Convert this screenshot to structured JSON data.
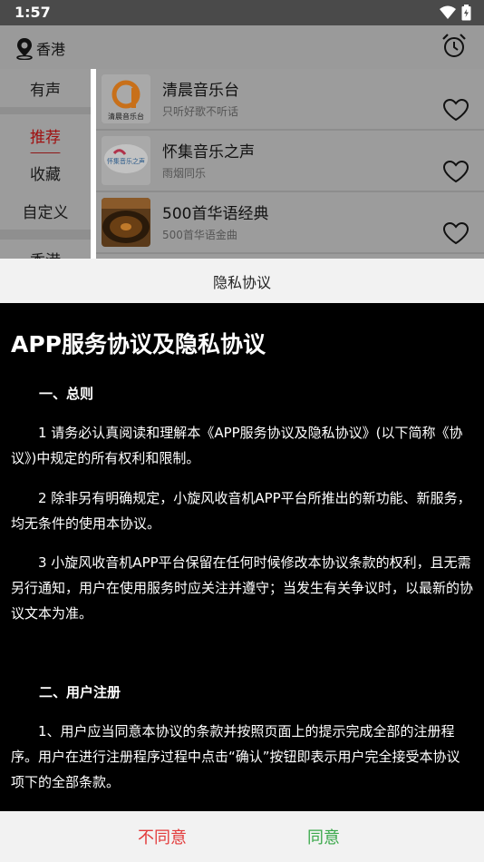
{
  "status_bar": {
    "time": "1:57"
  },
  "app_bar": {
    "location": "香港",
    "location_icon": "location-pin-icon",
    "alarm_icon": "alarm-clock-icon"
  },
  "categories": [
    {
      "label": "有声"
    },
    {
      "label": "推荐",
      "selected": true
    },
    {
      "label": "收藏"
    },
    {
      "label": "自定义"
    },
    {
      "label": "香港"
    }
  ],
  "stations": [
    {
      "name": "清晨音乐台",
      "desc": "只听好歌不听话",
      "logo_text": "清晨音乐台"
    },
    {
      "name": "怀集音乐之声",
      "desc": "雨烟同乐",
      "logo_text": "怀集音乐之声"
    },
    {
      "name": "500首华语经典",
      "desc": "500首华语金曲"
    }
  ],
  "dialog": {
    "title": "隐私协议",
    "doc_title": "APP服务协议及隐私协议",
    "sections": [
      {
        "heading": "一、总则",
        "paragraphs": [
          "1 请务必认真阅读和理解本《APP服务协议及隐私协议》(以下简称《协议》)中规定的所有权利和限制。",
          "2 除非另有明确规定，小旋风收音机APP平台所推出的新功能、新服务，均无条件的使用本协议。",
          "3 小旋风收音机APP平台保留在任何时候修改本协议条款的权利，且无需另行通知，用户在使用服务时应关注并遵守；当发生有关争议时，以最新的协议文本为准。"
        ]
      },
      {
        "heading": "二、用户注册",
        "paragraphs": [
          "1、用户应当同意本协议的条款并按照页面上的提示完成全部的注册程序。用户在进行注册程序过程中点击“确认”按钮即表示用户完全接受本协议项下的全部条款。"
        ]
      }
    ],
    "disagree_label": "不同意",
    "agree_label": "同意"
  },
  "colors": {
    "disagree": "#e23a3a",
    "agree": "#3aa84a",
    "selected_category": "#a01010"
  }
}
